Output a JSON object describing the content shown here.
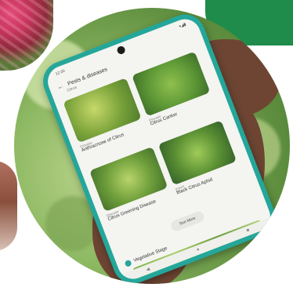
{
  "screen": {
    "status_time": "12:30",
    "status_icons": "▾◢▮",
    "back_glyph": "←",
    "header_title": "Pests & diseases",
    "header_sub": "Citrus",
    "cards": [
      {
        "type": "Disease",
        "name": "Anthracnose of Citrus"
      },
      {
        "type": "Disease",
        "name": "Citrus Canker"
      },
      {
        "type": "Disease",
        "name": "Citrus Greening Disease"
      },
      {
        "type": "Insect",
        "name": "Black Citrus Aphid"
      }
    ],
    "see_more": "See More",
    "stage_label": "Vegetative Stage",
    "nav": [
      "◀",
      "●",
      "■"
    ]
  },
  "colors": {
    "phone_case": "#24a79a",
    "banner": "#1f8c4b"
  }
}
